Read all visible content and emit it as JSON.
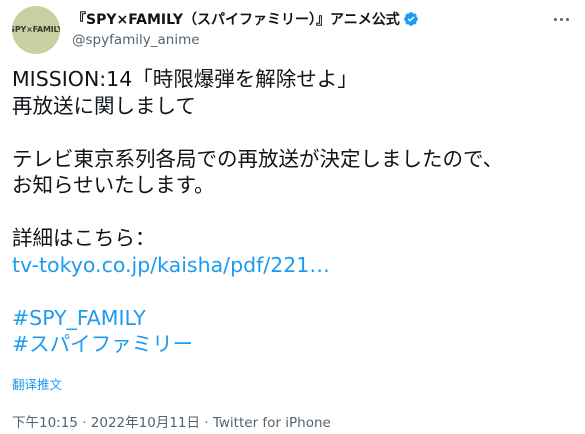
{
  "user": {
    "avatar_text": "SPY×FAMILY",
    "display_name": "『SPY×FAMILY（スパイファミリー）』アニメ公式",
    "handle": "@spyfamily_anime",
    "verified_color": "#1d9bf0"
  },
  "tweet": {
    "lines": [
      "MISSION:14「時限爆弾を解除せよ」",
      "再放送に関しまして",
      "テレビ東京系列各局での再放送が決定しましたので、",
      "お知らせいたします。",
      "詳細はこちら："
    ],
    "link_text": "tv-tokyo.co.jp/kaisha/pdf/221…",
    "hashtags": [
      "#SPY_FAMILY",
      "#スパイファミリー"
    ]
  },
  "translate_label": "翻译推文",
  "meta": {
    "time": "下午10:15",
    "separator1": " · ",
    "date": "2022年10月11日",
    "separator2": " · ",
    "source": "Twitter for iPhone"
  },
  "icons": {
    "verified": "verified-badge-icon",
    "more": "more-options-icon"
  }
}
